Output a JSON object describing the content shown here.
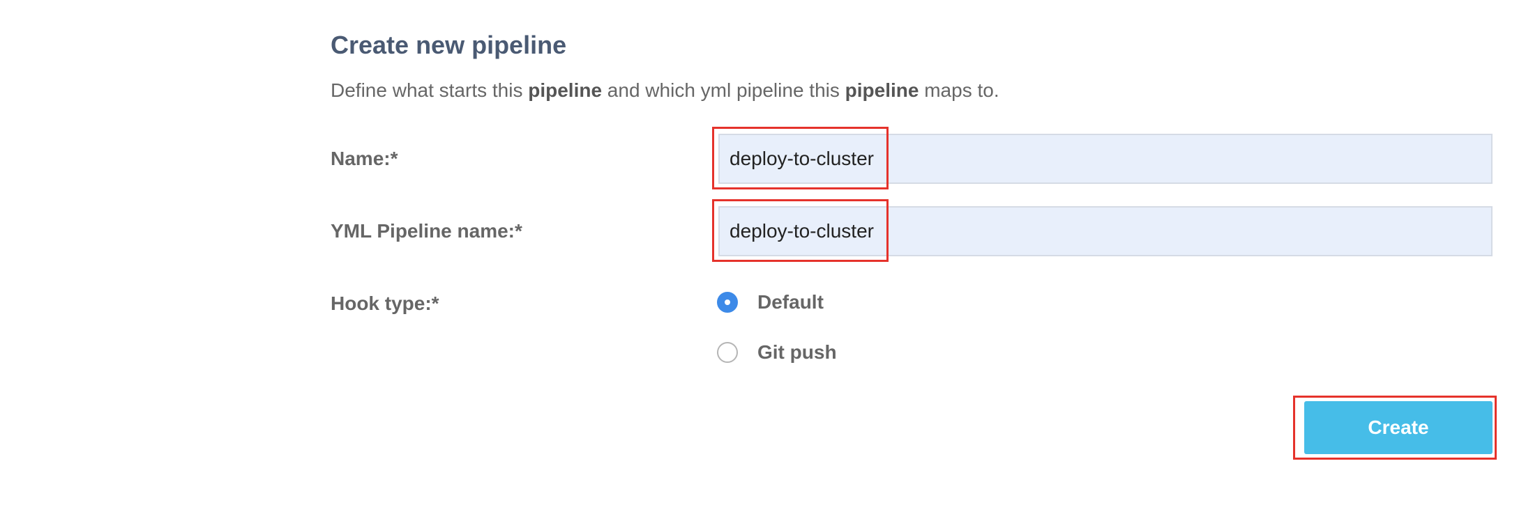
{
  "form": {
    "title": "Create new pipeline",
    "subtitle": {
      "part1": "Define what starts this ",
      "bold1": "pipeline",
      "part2": " and which yml pipeline this ",
      "bold2": "pipeline",
      "part3": " maps to."
    },
    "name": {
      "label": "Name:*",
      "value": "deploy-to-cluster"
    },
    "yml_pipeline": {
      "label": "YML Pipeline name:*",
      "value": "deploy-to-cluster"
    },
    "hook_type": {
      "label": "Hook type:*",
      "options": [
        {
          "label": "Default",
          "selected": true
        },
        {
          "label": "Git push",
          "selected": false
        }
      ]
    },
    "create_label": "Create"
  },
  "colors": {
    "accent": "#46bde8",
    "radio_selected": "#3d8ae8",
    "highlight": "#e5322b",
    "input_bg": "#e8effb",
    "title": "#4a5a73"
  }
}
